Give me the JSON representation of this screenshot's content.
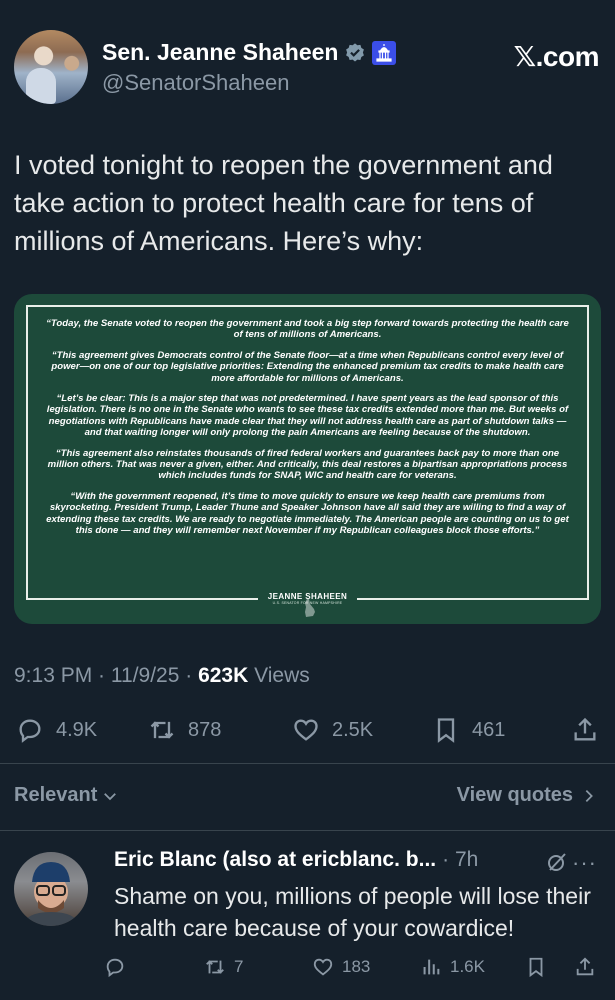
{
  "header": {
    "author_name": "Sen. Jeanne Shaheen",
    "handle": "@SenatorShaheen",
    "site_label": "𝕏.com",
    "icons": [
      "verified-badge-icon",
      "capitol-icon"
    ]
  },
  "tweet": {
    "text": "I voted tonight to reopen the government and take action to protect health care for tens of millions of Americans. Here’s why:"
  },
  "statement_image": {
    "paragraphs": [
      "“Today, the Senate voted to reopen the government and took a big step forward towards protecting the health care of tens of millions of Americans.",
      "“This agreement gives Democrats control of the Senate floor—at a time when Republicans control every level of power—on one of our top legislative priorities: Extending the enhanced premium tax credits to make health care more affordable for millions of Americans.",
      "“Let’s be clear: This is a major step that was not predetermined. I have spent years as the lead sponsor of this legislation. There is no one in the Senate who wants to see these tax credits extended more than me. But weeks of negotiations with Republicans have made clear that they will not address health care as part of shutdown talks — and that waiting longer will only prolong the pain Americans are feeling because of the shutdown.",
      "“This agreement also reinstates thousands of fired federal workers and guarantees back pay to more than one million others. That was never a given, either. And critically, this deal restores a bipartisan appropriations process which includes funds for SNAP, WIC and health care for veterans.",
      "“With the government reopened, it’s time to move quickly to ensure we keep health care premiums from skyrocketing. President Trump, Leader Thune and Speaker Johnson have all said they are willing to find a way of extending these tax credits. We are ready to negotiate immediately. The American people are counting on us to get this done — and they will remember next November if my Republican colleagues block those efforts.”"
    ],
    "signature": "JEANNE SHAHEEN",
    "signature_sub": "U.S. SENATOR FOR NEW HAMPSHIRE",
    "background": "#1d4a3a"
  },
  "meta": {
    "time": "9:13 PM",
    "sep1": " · ",
    "date": "11/9/25",
    "sep2": " · ",
    "views_count": "623K",
    "views_label": " Views"
  },
  "actions": {
    "replies": "4.9K",
    "reposts": "878",
    "likes": "2.5K",
    "bookmarks": "461"
  },
  "sort": {
    "relevant_label": "Relevant",
    "view_quotes_label": "View quotes"
  },
  "reply": {
    "name": "Eric Blanc (also at ericblanc. b...",
    "time": "· 7h",
    "text": "Shame on you, millions of people will lose their health care because of your cowardice!",
    "more": "···",
    "reposts": "7",
    "likes": "183",
    "views": "1.6K"
  },
  "colors": {
    "background": "#15202b",
    "text": "#e7e9ea",
    "muted": "#8b98a5",
    "verified": "#829aab",
    "divider": "#38444d"
  }
}
